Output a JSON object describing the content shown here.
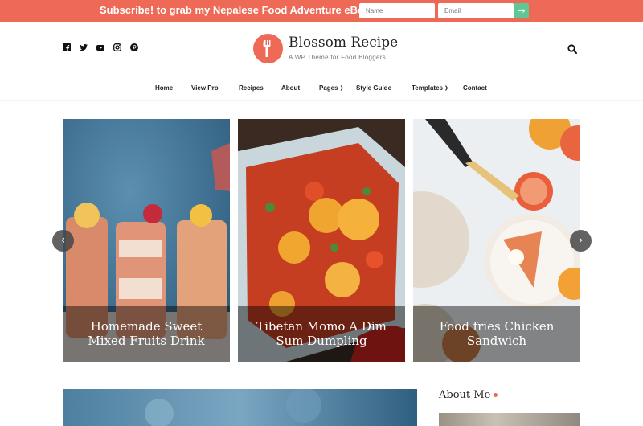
{
  "promo": {
    "text": "Subscribe! to grab my Nepalese Food Adventure eBook!",
    "name_placeholder": "Name",
    "email_placeholder": "Email",
    "submit_icon": "arrow-right-icon"
  },
  "header": {
    "social_icons": [
      "facebook-icon",
      "twitter-icon",
      "youtube-icon",
      "instagram-icon",
      "pinterest-icon"
    ],
    "site_title": "Blossom Recipe",
    "tagline": "A WP Theme for Food Bloggers",
    "logo_icon": "fork-icon",
    "search_icon": "search-icon"
  },
  "nav": {
    "items": [
      {
        "label": "Home"
      },
      {
        "label": "View Pro"
      },
      {
        "label": "Recipes"
      },
      {
        "label": "About"
      },
      {
        "label": "Pages",
        "has_dropdown": true
      },
      {
        "label": "Style Guide"
      },
      {
        "label": "Templates",
        "has_dropdown": true
      },
      {
        "label": "Contact"
      }
    ]
  },
  "slider": {
    "slides": [
      {
        "title": "Homemade Sweet Mixed Fruits Drink"
      },
      {
        "title": "Tibetan Momo A Dim Sum Dumpling"
      },
      {
        "title": "Food fries Chicken Sandwich"
      }
    ],
    "prev_icon": "chevron-left-icon",
    "next_icon": "chevron-right-icon"
  },
  "sidebar": {
    "about_title": "About Me"
  },
  "colors": {
    "accent": "#ee6a57",
    "submit": "#5fc794",
    "caption_overlay": "rgba(0,0,0,0.45)"
  }
}
